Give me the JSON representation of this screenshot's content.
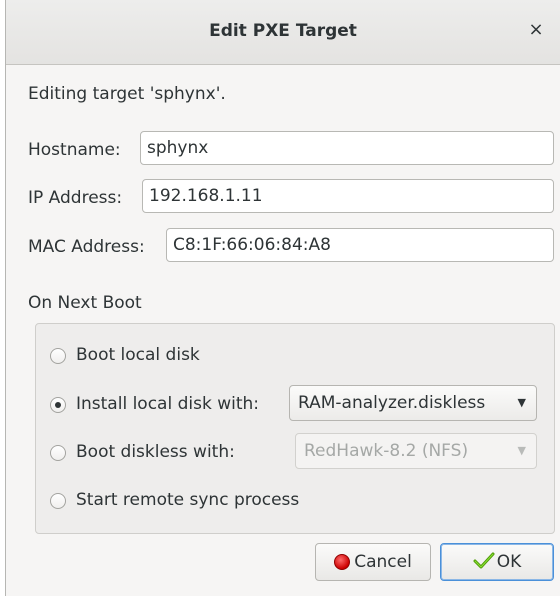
{
  "window": {
    "title": "Edit PXE Target",
    "close_glyph": "×"
  },
  "subtitle": "Editing target 'sphynx'.",
  "fields": {
    "hostname": {
      "label": "Hostname:",
      "value": "sphynx"
    },
    "ip": {
      "label": "IP Address:",
      "value": "192.168.1.11"
    },
    "mac": {
      "label": "MAC Address:",
      "value": "C8:1F:66:06:84:A8"
    }
  },
  "next_boot": {
    "label": "On Next Boot",
    "options": [
      {
        "label": "Boot local disk",
        "selected": false
      },
      {
        "label": "Install local disk with:",
        "selected": true,
        "combo": "RAM-analyzer.diskless",
        "combo_enabled": true
      },
      {
        "label": "Boot diskless with:",
        "selected": false,
        "combo": "RedHawk-8.2 (NFS)",
        "combo_enabled": false
      },
      {
        "label": "Start remote sync process",
        "selected": false
      }
    ]
  },
  "buttons": {
    "cancel": {
      "label": "Cancel",
      "icon": "stop-icon"
    },
    "ok": {
      "label": "OK",
      "icon": "check-icon"
    }
  },
  "colors": {
    "default_button_border": "#4a90d9",
    "cancel_icon": "#cc0000",
    "ok_icon": "#4e9a06"
  }
}
